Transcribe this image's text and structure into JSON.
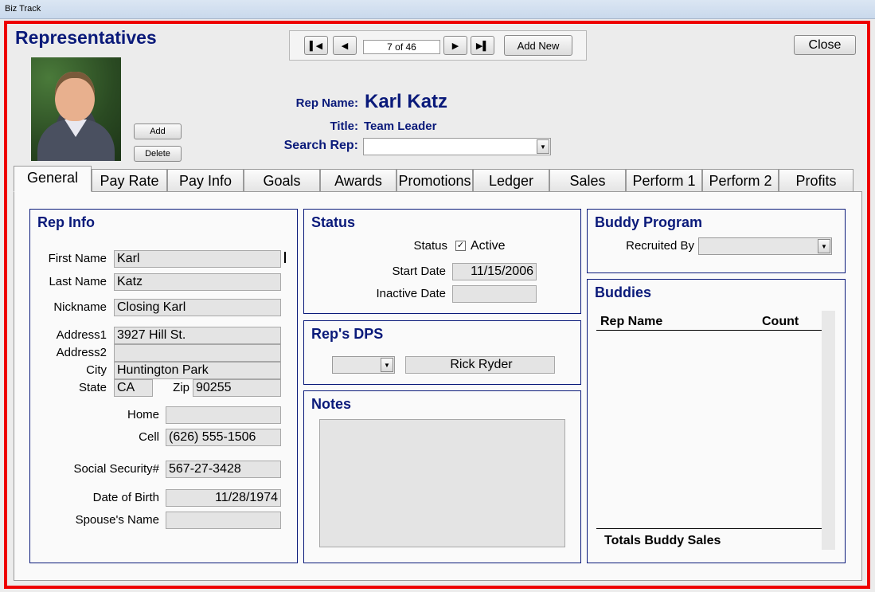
{
  "window": {
    "title": "Biz Track"
  },
  "header": {
    "heading": "Representatives",
    "record_counter": "7 of 46",
    "add_new_label": "Add New",
    "close_label": "Close",
    "photo_add_label": "Add",
    "photo_delete_label": "Delete",
    "rep_name_label": "Rep Name:",
    "rep_name_value": "Karl Katz",
    "title_label": "Title:",
    "title_value": "Team Leader",
    "search_label": "Search Rep:",
    "search_value": ""
  },
  "tabs": [
    "General",
    "Pay Rate",
    "Pay Info",
    "Goals",
    "Awards",
    "Promotions",
    "Ledger",
    "Sales",
    "Perform 1",
    "Perform 2",
    "Profits"
  ],
  "rep_info": {
    "title": "Rep Info",
    "first_name_label": "First Name",
    "first_name": "Karl",
    "last_name_label": "Last Name",
    "last_name": "Katz",
    "nickname_label": "Nickname",
    "nickname": "Closing Karl",
    "address1_label": "Address1",
    "address1": "3927 Hill St.",
    "address2_label": "Address2",
    "address2": "",
    "city_label": "City",
    "city": "Huntington Park",
    "state_label": "State",
    "state": "CA",
    "zip_label": "Zip",
    "zip": "90255",
    "home_label": "Home",
    "home": "",
    "cell_label": "Cell",
    "cell": "(626) 555-1506",
    "ssn_label": "Social Security#",
    "ssn": "567-27-3428",
    "dob_label": "Date of Birth",
    "dob": "11/28/1974",
    "spouse_label": "Spouse's Name",
    "spouse": ""
  },
  "status": {
    "title": "Status",
    "status_label": "Status",
    "active_label": "Active",
    "active_checked": true,
    "start_date_label": "Start Date",
    "start_date": "11/15/2006",
    "inactive_date_label": "Inactive Date",
    "inactive_date": ""
  },
  "dps": {
    "title": "Rep's DPS",
    "dropdown_value": "",
    "name": "Rick Ryder"
  },
  "notes": {
    "title": "Notes",
    "text": ""
  },
  "buddy_program": {
    "title": "Buddy Program",
    "recruited_by_label": "Recruited By",
    "recruited_by": ""
  },
  "buddies": {
    "title": "Buddies",
    "col_rep_name": "Rep Name",
    "col_count": "Count",
    "rows": [],
    "totals_label": "Totals Buddy Sales"
  },
  "icons": {
    "first": "first-record-icon",
    "prev": "previous-record-icon",
    "next": "next-record-icon",
    "last": "last-record-icon"
  },
  "colors": {
    "accent": "#0a1a7a",
    "frame": "#ee0000"
  }
}
